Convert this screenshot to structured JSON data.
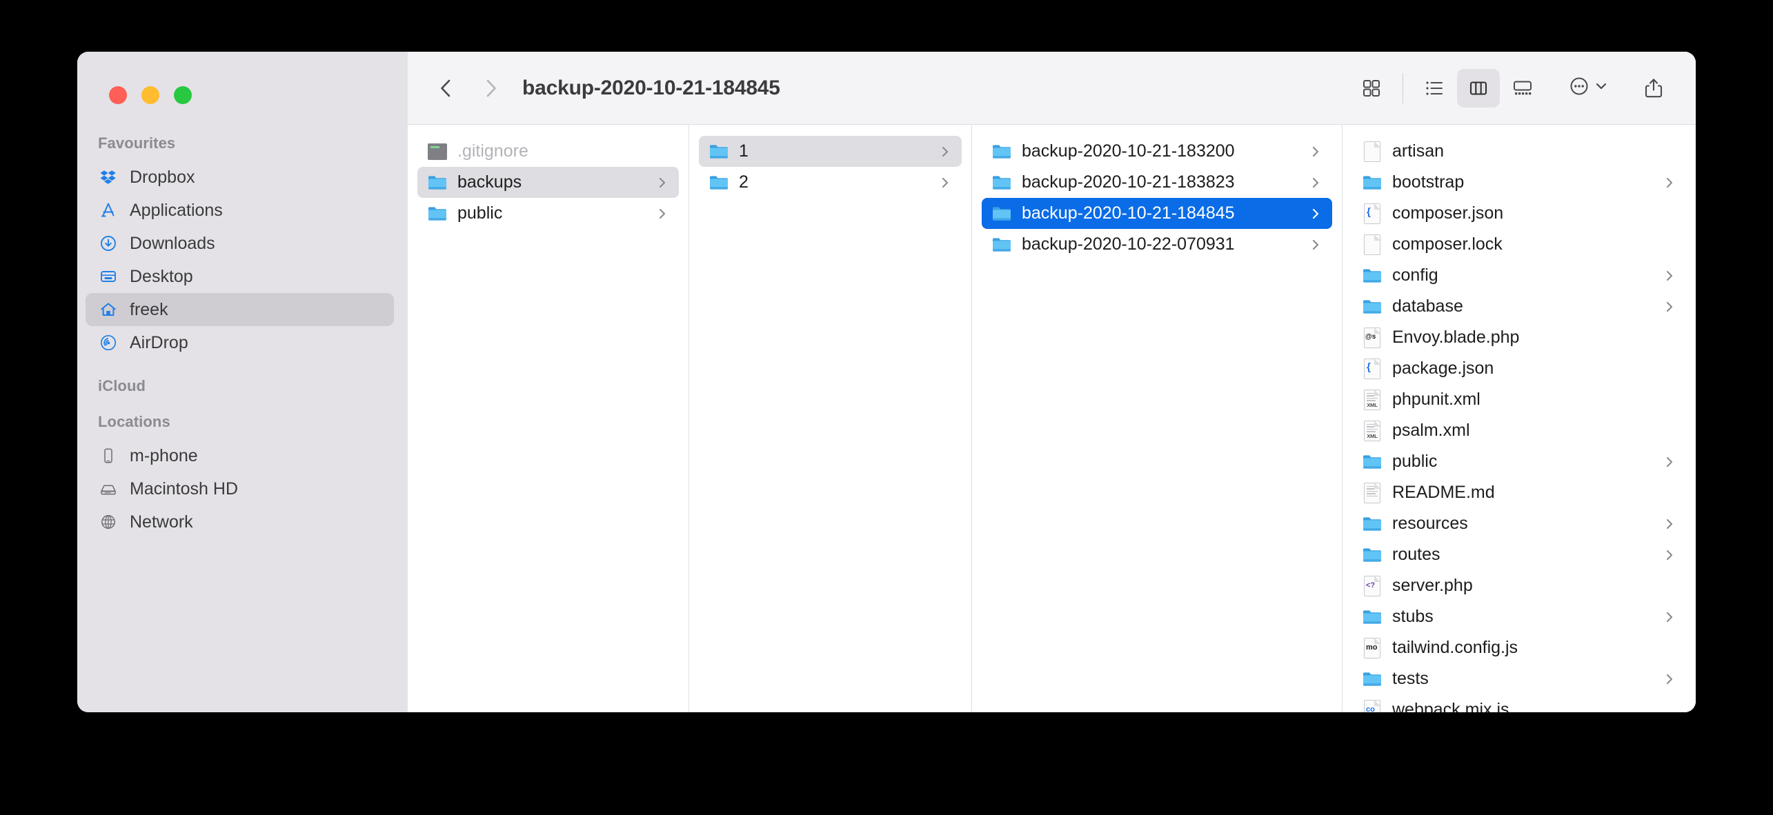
{
  "window": {
    "title": "backup-2020-10-21-184845",
    "accent_selection": "#0a6ce6",
    "sidebar_bg": "#e4e2e6",
    "toolbar_bg": "#f4f3f6"
  },
  "traffic_lights": {
    "close_label": "Close",
    "minimize_label": "Minimize",
    "maximize_label": "Maximize",
    "close_color": "#ff5f57",
    "minimize_color": "#febc2e",
    "maximize_color": "#28c840"
  },
  "toolbar": {
    "back_label": "Back",
    "forward_label": "Forward",
    "back_enabled": true,
    "forward_enabled": false,
    "views": [
      {
        "name": "icon-view",
        "label": "Icon view",
        "active": false
      },
      {
        "name": "list-view",
        "label": "List view",
        "active": false
      },
      {
        "name": "column-view",
        "label": "Column view",
        "active": true
      },
      {
        "name": "gallery-view",
        "label": "Gallery view",
        "active": false
      }
    ],
    "more_label": "More",
    "share_label": "Share"
  },
  "sidebar": {
    "sections": [
      {
        "title": "Favourites",
        "items": [
          {
            "label": "Dropbox",
            "icon": "dropbox-icon",
            "selected": false
          },
          {
            "label": "Applications",
            "icon": "applications-icon",
            "selected": false
          },
          {
            "label": "Downloads",
            "icon": "downloads-icon",
            "selected": false
          },
          {
            "label": "Desktop",
            "icon": "desktop-icon",
            "selected": false
          },
          {
            "label": "freek",
            "icon": "home-icon",
            "selected": true
          },
          {
            "label": "AirDrop",
            "icon": "airdrop-icon",
            "selected": false
          }
        ]
      },
      {
        "title": "iCloud",
        "items": []
      },
      {
        "title": "Locations",
        "items": [
          {
            "label": "m-phone",
            "icon": "iphone-icon",
            "selected": false
          },
          {
            "label": "Macintosh HD",
            "icon": "harddisk-icon",
            "selected": false
          },
          {
            "label": "Network",
            "icon": "globe-icon",
            "selected": false
          }
        ]
      }
    ]
  },
  "columns": [
    {
      "name": "column-1",
      "rows": [
        {
          "label": ".gitignore",
          "icon": "gitignore-file-icon",
          "kind": "file",
          "chevron": false,
          "selection": "none",
          "dimmed": true
        },
        {
          "label": "backups",
          "icon": "folder-icon",
          "kind": "folder",
          "chevron": true,
          "selection": "gray",
          "dimmed": false
        },
        {
          "label": "public",
          "icon": "folder-icon",
          "kind": "folder",
          "chevron": true,
          "selection": "none",
          "dimmed": false
        }
      ]
    },
    {
      "name": "column-2",
      "rows": [
        {
          "label": "1",
          "icon": "folder-icon",
          "kind": "folder",
          "chevron": true,
          "selection": "gray",
          "dimmed": false
        },
        {
          "label": "2",
          "icon": "folder-icon",
          "kind": "folder",
          "chevron": true,
          "selection": "none",
          "dimmed": false
        }
      ]
    },
    {
      "name": "column-3",
      "rows": [
        {
          "label": "backup-2020-10-21-183200",
          "icon": "folder-icon",
          "kind": "folder",
          "chevron": true,
          "selection": "none",
          "dimmed": false
        },
        {
          "label": "backup-2020-10-21-183823",
          "icon": "folder-icon",
          "kind": "folder",
          "chevron": true,
          "selection": "none",
          "dimmed": false
        },
        {
          "label": "backup-2020-10-21-184845",
          "icon": "folder-icon",
          "kind": "folder",
          "chevron": true,
          "selection": "blue",
          "dimmed": false
        },
        {
          "label": "backup-2020-10-22-070931",
          "icon": "folder-icon",
          "kind": "folder",
          "chevron": true,
          "selection": "none",
          "dimmed": false
        }
      ]
    },
    {
      "name": "column-4",
      "rows": [
        {
          "label": "artisan",
          "icon": "blank-file-icon",
          "kind": "file",
          "chevron": false,
          "selection": "none",
          "dimmed": false
        },
        {
          "label": "bootstrap",
          "icon": "folder-icon",
          "kind": "folder",
          "chevron": true,
          "selection": "none",
          "dimmed": false
        },
        {
          "label": "composer.json",
          "icon": "json-file-icon",
          "kind": "file",
          "chevron": false,
          "selection": "none",
          "dimmed": false
        },
        {
          "label": "composer.lock",
          "icon": "blank-file-icon",
          "kind": "file",
          "chevron": false,
          "selection": "none",
          "dimmed": false
        },
        {
          "label": "config",
          "icon": "folder-icon",
          "kind": "folder",
          "chevron": true,
          "selection": "none",
          "dimmed": false
        },
        {
          "label": "database",
          "icon": "folder-icon",
          "kind": "folder",
          "chevron": true,
          "selection": "none",
          "dimmed": false
        },
        {
          "label": "Envoy.blade.php",
          "icon": "at-file-icon",
          "kind": "file",
          "chevron": false,
          "selection": "none",
          "dimmed": false
        },
        {
          "label": "package.json",
          "icon": "json-file-icon",
          "kind": "file",
          "chevron": false,
          "selection": "none",
          "dimmed": false
        },
        {
          "label": "phpunit.xml",
          "icon": "xml-file-icon",
          "kind": "file",
          "chevron": false,
          "selection": "none",
          "dimmed": false
        },
        {
          "label": "psalm.xml",
          "icon": "xml-file-icon",
          "kind": "file",
          "chevron": false,
          "selection": "none",
          "dimmed": false
        },
        {
          "label": "public",
          "icon": "folder-icon",
          "kind": "folder",
          "chevron": true,
          "selection": "none",
          "dimmed": false
        },
        {
          "label": "README.md",
          "icon": "text-file-icon",
          "kind": "file",
          "chevron": false,
          "selection": "none",
          "dimmed": false
        },
        {
          "label": "resources",
          "icon": "folder-icon",
          "kind": "folder",
          "chevron": true,
          "selection": "none",
          "dimmed": false
        },
        {
          "label": "routes",
          "icon": "folder-icon",
          "kind": "folder",
          "chevron": true,
          "selection": "none",
          "dimmed": false
        },
        {
          "label": "server.php",
          "icon": "php-file-icon",
          "kind": "file",
          "chevron": false,
          "selection": "none",
          "dimmed": false
        },
        {
          "label": "stubs",
          "icon": "folder-icon",
          "kind": "folder",
          "chevron": true,
          "selection": "none",
          "dimmed": false
        },
        {
          "label": "tailwind.config.js",
          "icon": "mo-file-icon",
          "kind": "file",
          "chevron": false,
          "selection": "none",
          "dimmed": false
        },
        {
          "label": "tests",
          "icon": "folder-icon",
          "kind": "folder",
          "chevron": true,
          "selection": "none",
          "dimmed": false
        },
        {
          "label": "webpack.mix.js",
          "icon": "co-file-icon",
          "kind": "file",
          "chevron": false,
          "selection": "none",
          "dimmed": false
        }
      ]
    }
  ]
}
